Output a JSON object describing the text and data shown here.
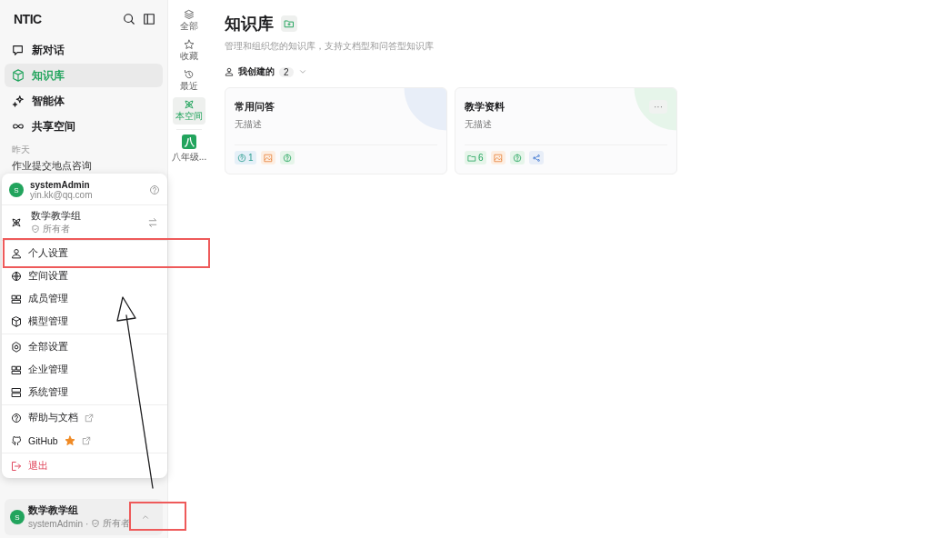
{
  "sidebar": {
    "logo": "NTIC",
    "nav": [
      {
        "label": "新对话",
        "selected": false
      },
      {
        "label": "知识库",
        "selected": true
      },
      {
        "label": "智能体",
        "selected": false
      },
      {
        "label": "共享空间",
        "selected": false
      }
    ],
    "history_heading": "昨天",
    "history": [
      "作业提交地点咨询"
    ],
    "footer": {
      "avatar": "S",
      "space": "数学教学组",
      "user": "systemAdmin",
      "separator": "·",
      "role": "所有者"
    }
  },
  "user_menu": {
    "avatar": "S",
    "name": "systemAdmin",
    "email": "yin.kk@qq.com",
    "space": {
      "name": "数学教学组",
      "role": "所有者"
    },
    "groups": [
      [
        {
          "label": "个人设置",
          "kind": "normal",
          "external": false
        },
        {
          "label": "空间设置",
          "kind": "normal",
          "external": false
        },
        {
          "label": "成员管理",
          "kind": "normal",
          "external": false
        },
        {
          "label": "模型管理",
          "kind": "normal",
          "external": false
        }
      ],
      [
        {
          "label": "全部设置",
          "kind": "normal",
          "external": false
        },
        {
          "label": "企业管理",
          "kind": "normal",
          "external": false
        },
        {
          "label": "系统管理",
          "kind": "normal",
          "external": false
        }
      ],
      [
        {
          "label": "帮助与文档",
          "kind": "normal",
          "external": true
        },
        {
          "label": "GitHub",
          "kind": "normal",
          "external": true
        }
      ],
      [
        {
          "label": "退出",
          "kind": "danger",
          "external": false
        }
      ]
    ]
  },
  "rail": {
    "items": [
      {
        "label": "全部",
        "selected": false
      },
      {
        "label": "收藏",
        "selected": false
      },
      {
        "label": "最近",
        "selected": false
      },
      {
        "label": "本空间",
        "selected": true
      }
    ],
    "spaces": [
      {
        "letter": "八",
        "label": "八年级..."
      }
    ]
  },
  "main": {
    "title": "知识库",
    "subtitle": "管理和组织您的知识库，支持文档型和问答型知识库",
    "filter": {
      "label": "我创建的",
      "count": "2"
    },
    "cards": [
      {
        "title": "常用问答",
        "description": "无描述",
        "tags": [
          {
            "kind": "qa",
            "count": "1"
          },
          {
            "kind": "image"
          },
          {
            "kind": "question"
          }
        ]
      },
      {
        "title": "教学资料",
        "description": "无描述",
        "more": "···",
        "tags": [
          {
            "kind": "folder",
            "count": "6"
          },
          {
            "kind": "image"
          },
          {
            "kind": "question"
          },
          {
            "kind": "share"
          }
        ]
      }
    ]
  }
}
